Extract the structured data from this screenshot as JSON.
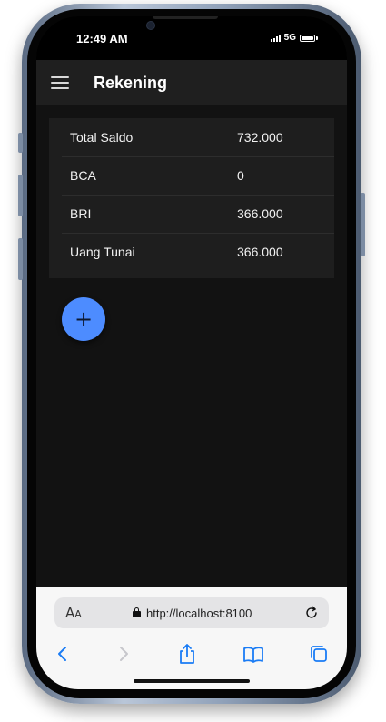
{
  "status_bar": {
    "time": "12:49 AM",
    "network": "5G"
  },
  "header": {
    "title": "Rekening"
  },
  "accounts": [
    {
      "name": "Total Saldo",
      "amount": "732.000"
    },
    {
      "name": "BCA",
      "amount": "0"
    },
    {
      "name": "BRI",
      "amount": "366.000"
    },
    {
      "name": "Uang Tunai",
      "amount": "366.000"
    }
  ],
  "fab": {
    "icon": "plus-icon",
    "symbol": "+"
  },
  "browser": {
    "text_size_label": "AA",
    "url": "http://localhost:8100",
    "icons": [
      "lock-icon",
      "reload-icon",
      "back-icon",
      "forward-icon",
      "share-icon",
      "bookmarks-icon",
      "tabs-icon"
    ]
  },
  "colors": {
    "accent": "#4d8cff",
    "background": "#121212",
    "toolbar": "#1f1f1f",
    "card": "#1e1e1e",
    "browser_blue": "#1a7cf5"
  }
}
